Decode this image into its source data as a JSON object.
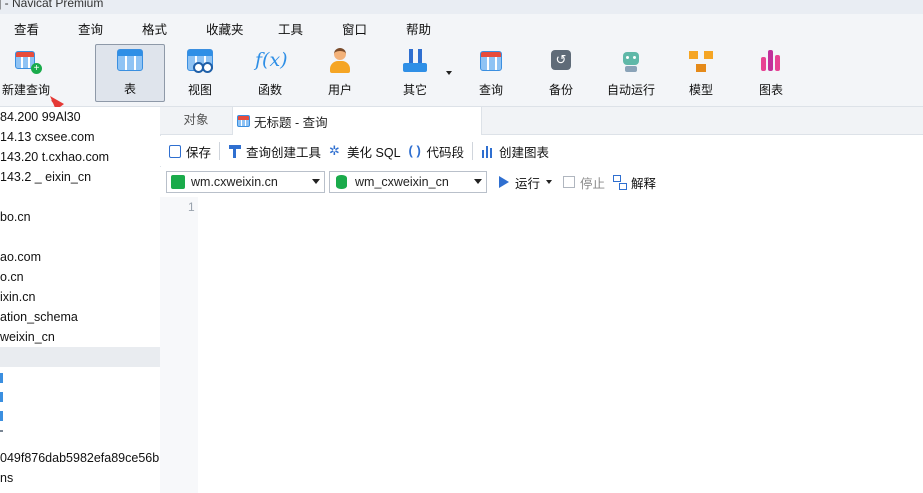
{
  "window": {
    "title": "] - Navicat Premium"
  },
  "menu": [
    "查看",
    "查询",
    "格式",
    "收藏夹",
    "工具",
    "窗口",
    "帮助"
  ],
  "toolbar": {
    "new_query": "新建查询",
    "table": "表",
    "view": "视图",
    "function": "函数",
    "function_glyph": "f(x)",
    "user": "用户",
    "other": "其它",
    "query": "查询",
    "backup": "备份",
    "auto_run": "自动运行",
    "model": "模型",
    "chart": "图表"
  },
  "sidebar": {
    "items": [
      "84.200 99Al30",
      "14.13     cxsee.com",
      "143.20    t.cxhao.com",
      "143.2       _ eixin_cn",
      "bo.cn",
      "ao.com",
      "o.cn",
      "ixin.cn",
      "ation_schema",
      "weixin_cn",
      "049f876dab5982efa89ce56b",
      "ns"
    ]
  },
  "tabs": {
    "objects": "对象",
    "query_tab": "无标题 - 查询"
  },
  "query_toolbar": {
    "save": "保存",
    "builder": "查询创建工具",
    "beautify": "美化 SQL",
    "snippet": "代码段",
    "snippet_glyph": "( )",
    "create_chart": "创建图表"
  },
  "selectors": {
    "connection": "wm.cxweixin.cn",
    "database": "wm_cxweixin_cn",
    "run": "运行",
    "stop": "停止",
    "explain": "解释"
  },
  "editor": {
    "line_number": "1"
  },
  "colors": {
    "accent": "#2f8fe6",
    "arrow": "#e53935",
    "db_green": "#1aab4b"
  }
}
